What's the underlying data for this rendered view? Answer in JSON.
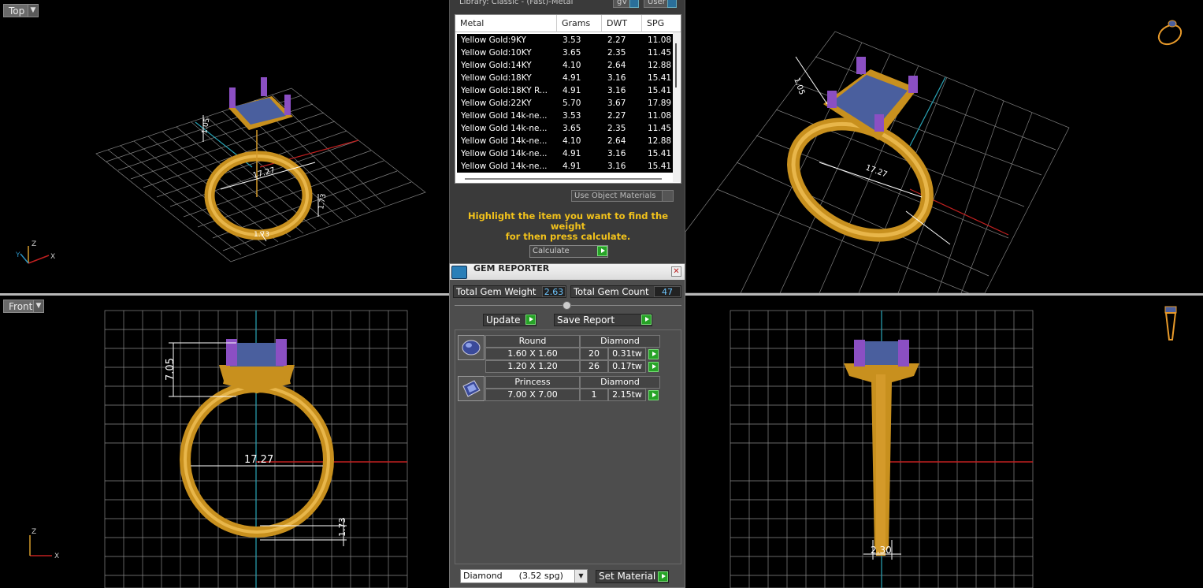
{
  "viewports": {
    "top": {
      "label": "Top",
      "dim_size": "17.27",
      "dim_height": "1.05",
      "dim_small_a": "1.73",
      "dim_small_b": "1.73"
    },
    "perspective": {
      "dim_height": "1.05",
      "dim_size": "17.27"
    },
    "front": {
      "label": "Front",
      "dim_height": "7.05",
      "dim_size": "17.27",
      "dim_small": "1.73"
    },
    "side": {
      "dim_width": "2.30"
    }
  },
  "metal_weight": {
    "library_title": "Library: Classic - (Fast)-Metal",
    "btn_a": "gV",
    "btn_b": "User",
    "columns": [
      "Metal",
      "Grams",
      "DWT",
      "SPG"
    ],
    "rows": [
      [
        "Yellow Gold:9KY",
        "3.53",
        "2.27",
        "11.08"
      ],
      [
        "Yellow Gold:10KY",
        "3.65",
        "2.35",
        "11.45"
      ],
      [
        "Yellow Gold:14KY",
        "4.10",
        "2.64",
        "12.88"
      ],
      [
        "Yellow Gold:18KY",
        "4.91",
        "3.16",
        "15.41"
      ],
      [
        "Yellow Gold:18KY R...",
        "4.91",
        "3.16",
        "15.41"
      ],
      [
        "Yellow Gold:22KY",
        "5.70",
        "3.67",
        "17.89"
      ],
      [
        "Yellow Gold 14k-ne...",
        "3.53",
        "2.27",
        "11.08"
      ],
      [
        "Yellow Gold 14k-ne...",
        "3.65",
        "2.35",
        "11.45"
      ],
      [
        "Yellow Gold 14k-ne...",
        "4.10",
        "2.64",
        "12.88"
      ],
      [
        "Yellow Gold 14k-ne...",
        "4.91",
        "3.16",
        "15.41"
      ],
      [
        "Yellow Gold 14k-ne...",
        "4.91",
        "3.16",
        "15.41"
      ]
    ],
    "use_object_materials": "Use Object Materials",
    "highlight_line1": "Highlight the item you want to find the weight",
    "highlight_line2": "for then press calculate.",
    "calculate": "Calculate"
  },
  "gem_reporter": {
    "title": "GEM REPORTER",
    "total_weight_label": "Total Gem Weight",
    "total_weight_value": "2.63",
    "total_count_label": "Total Gem Count",
    "total_count_value": "47",
    "update": "Update",
    "save_report": "Save Report",
    "groups": [
      {
        "shape": "Round",
        "material": "Diamond",
        "icon": "round-gem-icon",
        "rows": [
          {
            "size": "1.60 X 1.60",
            "count": "20",
            "weight": "0.31tw"
          },
          {
            "size": "1.20 X 1.20",
            "count": "26",
            "weight": "0.17tw"
          }
        ]
      },
      {
        "shape": "Princess",
        "material": "Diamond",
        "icon": "princess-gem-icon",
        "rows": [
          {
            "size": "7.00 X 7.00",
            "count": "1",
            "weight": "2.15tw"
          }
        ]
      }
    ],
    "material_select": "Diamond      (3.52 spg)",
    "set_material": "Set Material"
  },
  "colors": {
    "gold": "#d49a2a",
    "stone": "#4a5f9e",
    "prong": "#8b4fc3",
    "grid": "#7a7a7a",
    "highlight": "#f2c21b"
  }
}
